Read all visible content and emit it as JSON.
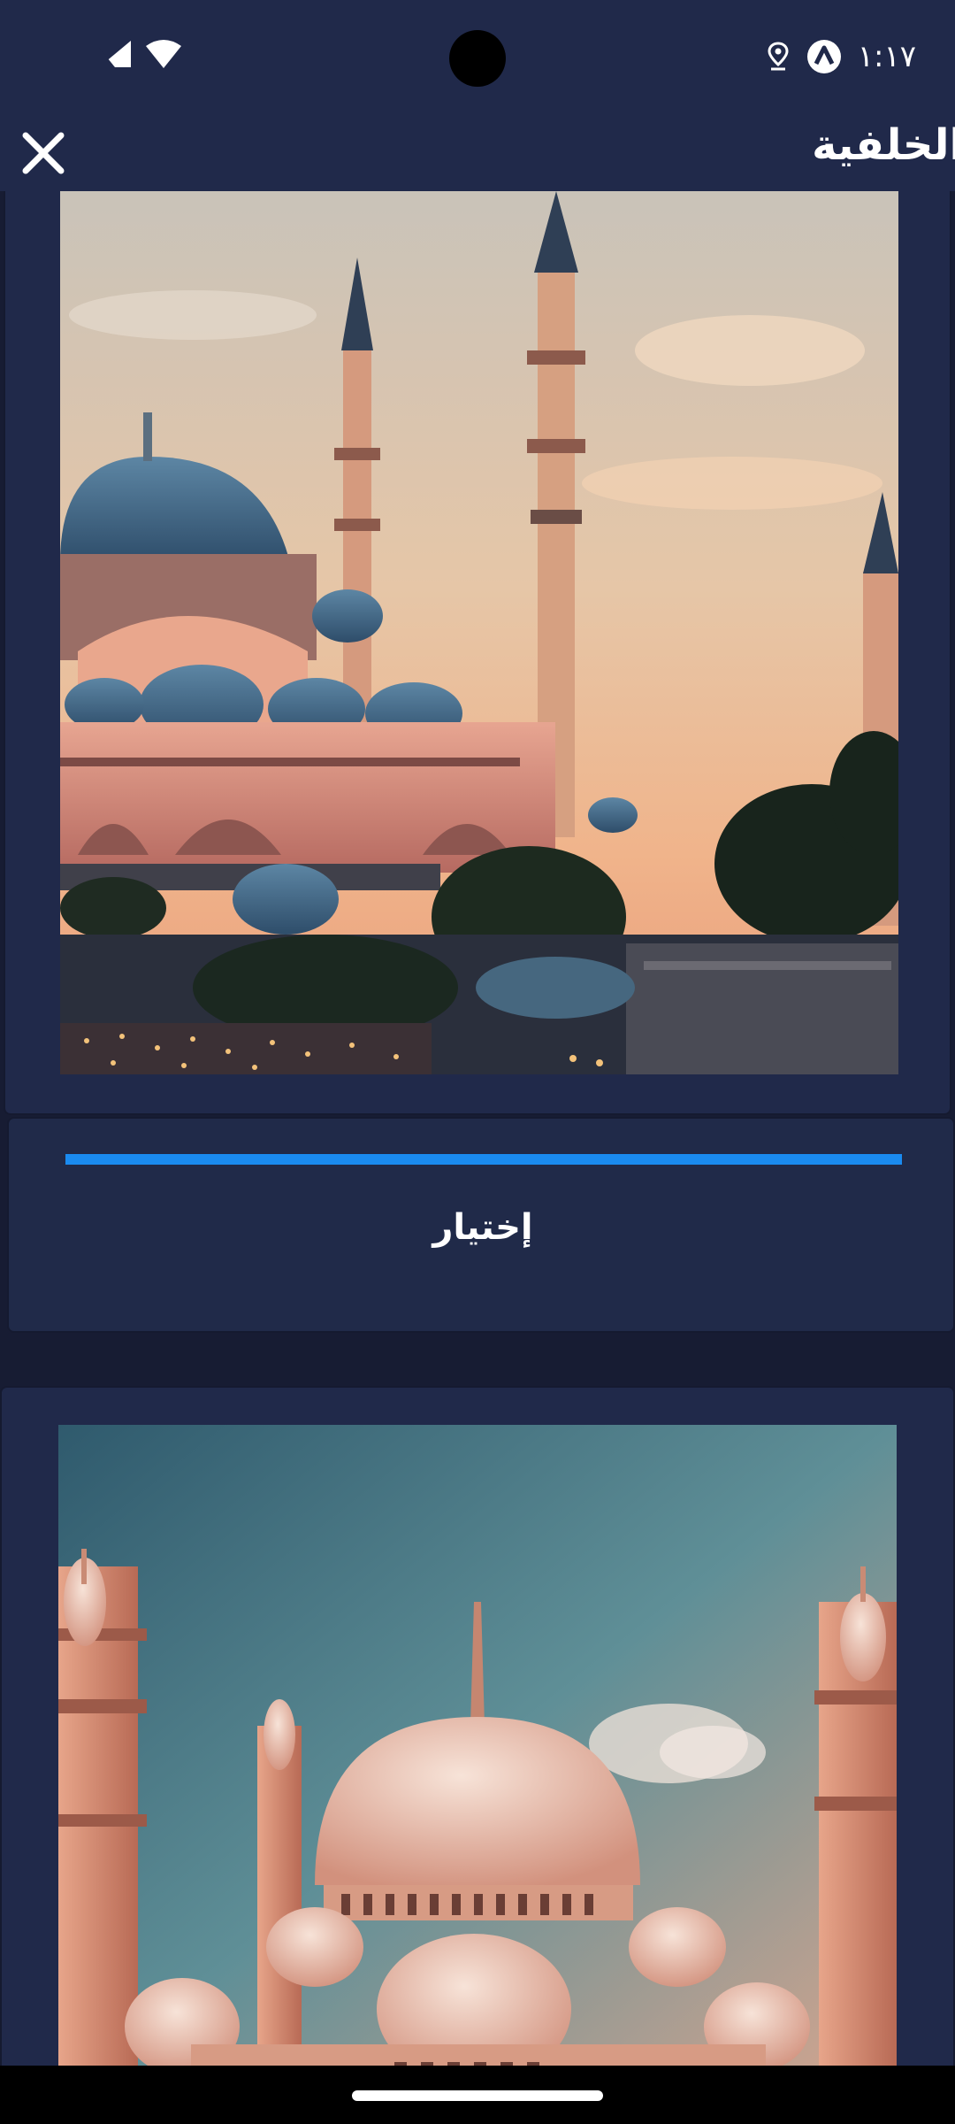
{
  "status_bar": {
    "time": "١:١٧",
    "icons": [
      "signal-icon",
      "wifi-icon",
      "nav-app-icon",
      "location-icon"
    ]
  },
  "app_bar": {
    "title": "الخلفية",
    "close_icon": "close-icon"
  },
  "wallpapers": [
    {
      "select_label": "إختيار",
      "progress": 1.0
    }
  ],
  "colors": {
    "background": "#171c33",
    "surface": "#20294a",
    "accent": "#1a8bf0",
    "text": "#ffffff"
  }
}
